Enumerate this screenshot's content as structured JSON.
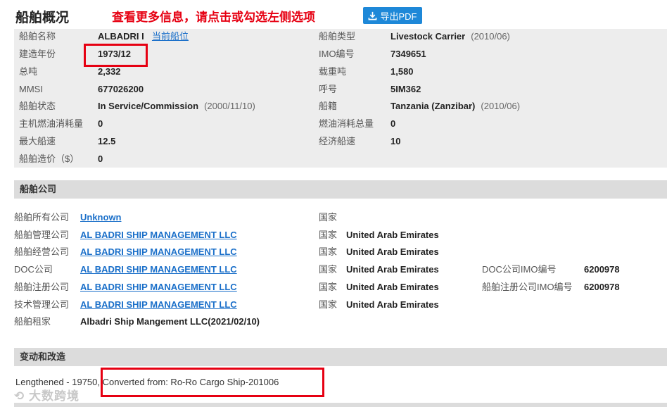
{
  "header": {
    "title": "船舶概况",
    "hint": "查看更多信息，请点击或勾选左侧选项",
    "pdf_button": "导出PDF"
  },
  "overview": {
    "left": [
      {
        "label": "船舶名称",
        "value": "ALBADRI I",
        "link": "当前船位"
      },
      {
        "label": "建造年份",
        "value": "1973/12"
      },
      {
        "label": "总吨",
        "value": "2,332"
      },
      {
        "label": "MMSI",
        "value": "677026200"
      },
      {
        "label": "船舶状态",
        "value": "In Service/Commission",
        "note": "(2000/11/10)"
      },
      {
        "label": "主机燃油消耗量",
        "value": "0"
      },
      {
        "label": "最大船速",
        "value": "12.5"
      },
      {
        "label": "船舶造价（$）",
        "value": "0"
      }
    ],
    "right": [
      {
        "label": "船舶类型",
        "value": "Livestock Carrier",
        "note": "(2010/06)"
      },
      {
        "label": "IMO编号",
        "value": "7349651"
      },
      {
        "label": "载重吨",
        "value": "1,580"
      },
      {
        "label": "呼号",
        "value": "5IM362"
      },
      {
        "label": "船籍",
        "value": "Tanzania (Zanzibar)",
        "note": "(2010/06)"
      },
      {
        "label": "燃油消耗总量",
        "value": "0"
      },
      {
        "label": "经济船速",
        "value": "10"
      }
    ]
  },
  "company": {
    "section_title": "船舶公司",
    "rows": [
      {
        "label": "船舶所有公司",
        "name": "Unknown",
        "country_label": "国家",
        "country": ""
      },
      {
        "label": "船舶管理公司",
        "name": "AL BADRI SHIP MANAGEMENT LLC",
        "country_label": "国家",
        "country": "United Arab Emirates"
      },
      {
        "label": "船舶经营公司",
        "name": "AL BADRI SHIP MANAGEMENT LLC",
        "country_label": "国家",
        "country": "United Arab Emirates"
      },
      {
        "label": "DOC公司",
        "name": "AL BADRI SHIP MANAGEMENT LLC",
        "country_label": "国家",
        "country": "United Arab Emirates",
        "extra_label": "DOC公司IMO编号",
        "extra_value": "6200978"
      },
      {
        "label": "船舶注册公司",
        "name": "AL BADRI SHIP MANAGEMENT LLC",
        "country_label": "国家",
        "country": "United Arab Emirates",
        "extra_label": "船舶注册公司IMO编号",
        "extra_value": "6200978"
      },
      {
        "label": "技术管理公司",
        "name": "AL BADRI SHIP MANAGEMENT LLC",
        "country_label": "国家",
        "country": "United Arab Emirates"
      },
      {
        "label": "船舶租家",
        "name": "Albadri Ship Mangement LLC(2021/02/10)"
      }
    ]
  },
  "changes": {
    "section_title": "变动和改造",
    "text_a": "Lengthened - 19750",
    "text_b": ", Converted from: Ro-Ro Cargo Ship-201006"
  },
  "watermark": "大数跨境",
  "colors": {
    "accent": "#1e88d8",
    "highlight": "#e60012",
    "link": "#1a6fc9"
  }
}
